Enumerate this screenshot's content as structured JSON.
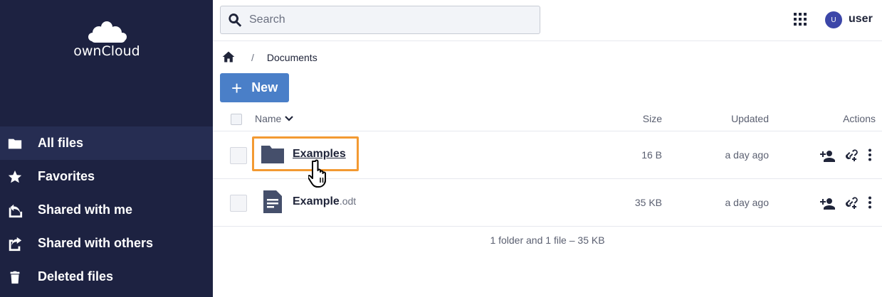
{
  "brand": {
    "logo_text": "ownCloud"
  },
  "sidebar": {
    "items": [
      {
        "label": "All files",
        "icon": "folder-icon",
        "active": true
      },
      {
        "label": "Favorites",
        "icon": "star-icon"
      },
      {
        "label": "Shared with me",
        "icon": "shared-with-me-icon"
      },
      {
        "label": "Shared with others",
        "icon": "shared-with-others-icon"
      },
      {
        "label": "Deleted files",
        "icon": "trash-icon"
      }
    ]
  },
  "header": {
    "search_placeholder": "Search",
    "user": {
      "initial": "U",
      "name": "user"
    }
  },
  "breadcrumb": {
    "home_icon": "home-icon",
    "separator": "/",
    "current": "Documents"
  },
  "toolbar": {
    "new_label": "New",
    "new_icon": "plus-icon"
  },
  "table": {
    "columns": {
      "name": "Name",
      "size": "Size",
      "updated": "Updated",
      "actions": "Actions"
    },
    "rows": [
      {
        "name": "Examples",
        "ext": "",
        "type": "folder",
        "size": "16 B",
        "updated": "a day ago"
      },
      {
        "name": "Example",
        "ext": ".odt",
        "type": "document",
        "size": "35 KB",
        "updated": "a day ago"
      }
    ],
    "summary": "1 folder and 1 file – 35 KB"
  },
  "colors": {
    "sidebar_bg": "#1d2241",
    "sidebar_active": "#262d52",
    "primary_button": "#4a7fc8",
    "highlight": "#f39a32",
    "avatar": "#3c46a8"
  }
}
